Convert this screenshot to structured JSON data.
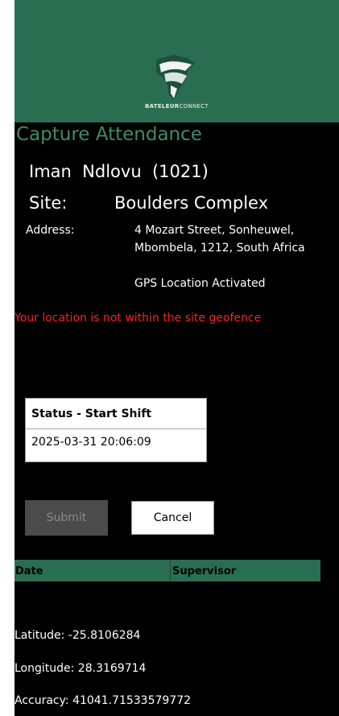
{
  "header": {
    "brand_part1": "BATELEUR",
    "brand_part2": "CONNECT"
  },
  "page": {
    "title": "Capture Attendance"
  },
  "employee": {
    "name_line": "Iman  Ndlovu  (1021)"
  },
  "site": {
    "label": "Site:",
    "value": "Boulders Complex"
  },
  "address": {
    "label": "Address:",
    "line1": "4 Mozart Street, Sonheuwel,",
    "line2": "Mbombela, 1212, South Africa"
  },
  "gps_status": "GPS Location Activated",
  "geofence_warning": "Your location is not within the site geofence",
  "status_box": {
    "title": "Status - Start Shift",
    "timestamp": "2025-03-31 20:06:09"
  },
  "buttons": {
    "submit": "Submit",
    "cancel": "Cancel"
  },
  "table": {
    "columns": [
      "Date",
      "Supervisor"
    ]
  },
  "location": {
    "latitude_text": "Latitude: -25.8106284",
    "longitude_text": "Longitude: 28.3169714",
    "accuracy_text": "Accuracy: 41041.71533579772"
  },
  "colors": {
    "header_green": "#2a6e52",
    "title_green": "#3e8d67",
    "warning_red": "#ff1f1f"
  }
}
